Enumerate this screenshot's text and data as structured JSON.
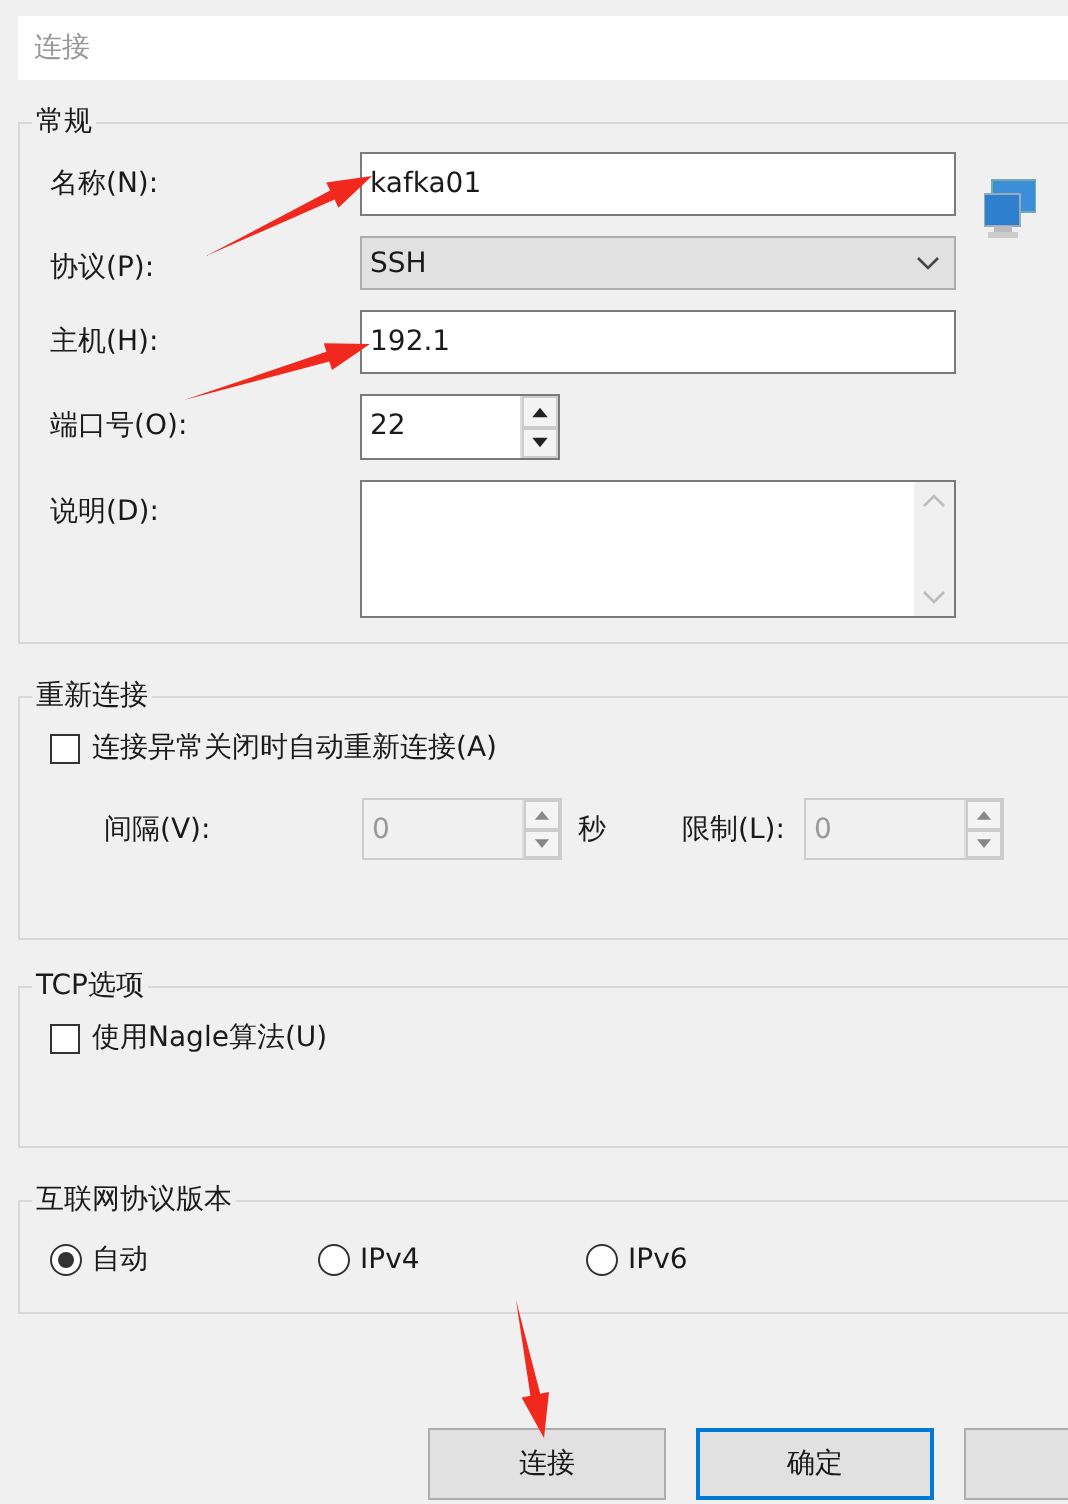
{
  "header": {
    "text": "连接"
  },
  "general": {
    "title": "常规",
    "fields": [
      {
        "kind": "text",
        "label": "名称(N):",
        "value": "kafka01"
      },
      {
        "kind": "select",
        "label": "协议(P):",
        "value": "SSH"
      },
      {
        "kind": "text",
        "label": "主机(H):",
        "value": "192.1"
      },
      {
        "kind": "spin",
        "label": "端口号(O):",
        "value": "22",
        "disabled": false
      },
      {
        "kind": "textarea",
        "label": "说明(D):"
      }
    ]
  },
  "reconnect": {
    "title": "重新连接",
    "checkbox": {
      "label": "连接异常关闭时自动重新连接(A)",
      "checked": false
    },
    "interval": {
      "label": "间隔(V):",
      "value": "0",
      "unit": "秒",
      "disabled": true
    },
    "limit": {
      "label": "限制(L):",
      "value": "0",
      "disabled": true
    }
  },
  "tcp": {
    "title": "TCP选项",
    "checkbox": {
      "label": "使用Nagle算法(U)",
      "checked": false
    }
  },
  "ip_version": {
    "title": "互联网协议版本",
    "options": [
      {
        "label": "自动",
        "selected": true
      },
      {
        "label": "IPv4",
        "selected": false
      },
      {
        "label": "IPv6",
        "selected": false
      }
    ]
  },
  "buttons": [
    {
      "label": "连接",
      "focused": false
    },
    {
      "label": "确定",
      "focused": true
    },
    {
      "focused": false
    }
  ],
  "annotation_arrows": [
    {
      "kind": "arrow"
    },
    {
      "kind": "arrow"
    },
    {
      "kind": "arrow"
    }
  ]
}
